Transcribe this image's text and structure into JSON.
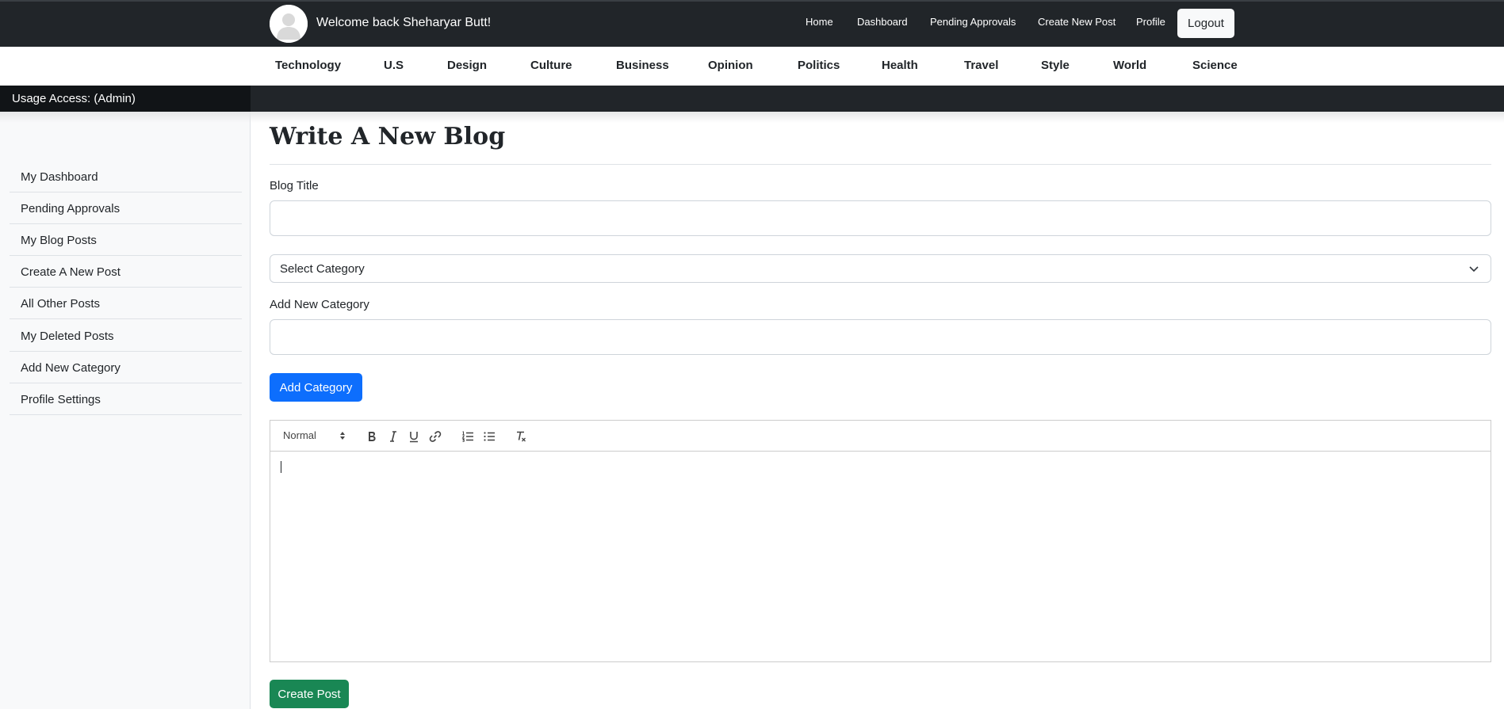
{
  "header": {
    "welcome": "Welcome back Sheharyar Butt!",
    "nav": [
      "Home",
      "Dashboard",
      "Pending Approvals",
      "Create New Post",
      "Profile"
    ],
    "logout": "Logout"
  },
  "categories": [
    "Technology",
    "U.S",
    "Design",
    "Culture",
    "Business",
    "Opinion",
    "Politics",
    "Health",
    "Travel",
    "Style",
    "World",
    "Science"
  ],
  "access": {
    "label": "Usage Access: (Admin)"
  },
  "sidebar": {
    "items": [
      "My Dashboard",
      "Pending Approvals",
      "My Blog Posts",
      "Create A New Post",
      "All Other Posts",
      "My Deleted Posts",
      "Add New Category",
      "Profile Settings"
    ]
  },
  "form": {
    "heading": "Write A New Blog",
    "title_label": "Blog Title",
    "title_value": "",
    "category_select": "Select Category",
    "new_category_label": "Add New Category",
    "new_category_value": "",
    "add_category_button": "Add Category",
    "editor_format": "Normal",
    "create_button": "Create Post"
  },
  "colors": {
    "dark": "#212529",
    "primary": "#0d6efd",
    "success": "#198754",
    "sidebar_bg": "#f8f9fa"
  },
  "icons": [
    "user-avatar-icon",
    "chevron-down-icon",
    "bold-icon",
    "italic-icon",
    "underline-icon",
    "link-icon",
    "ordered-list-icon",
    "bullet-list-icon",
    "clear-format-icon"
  ]
}
